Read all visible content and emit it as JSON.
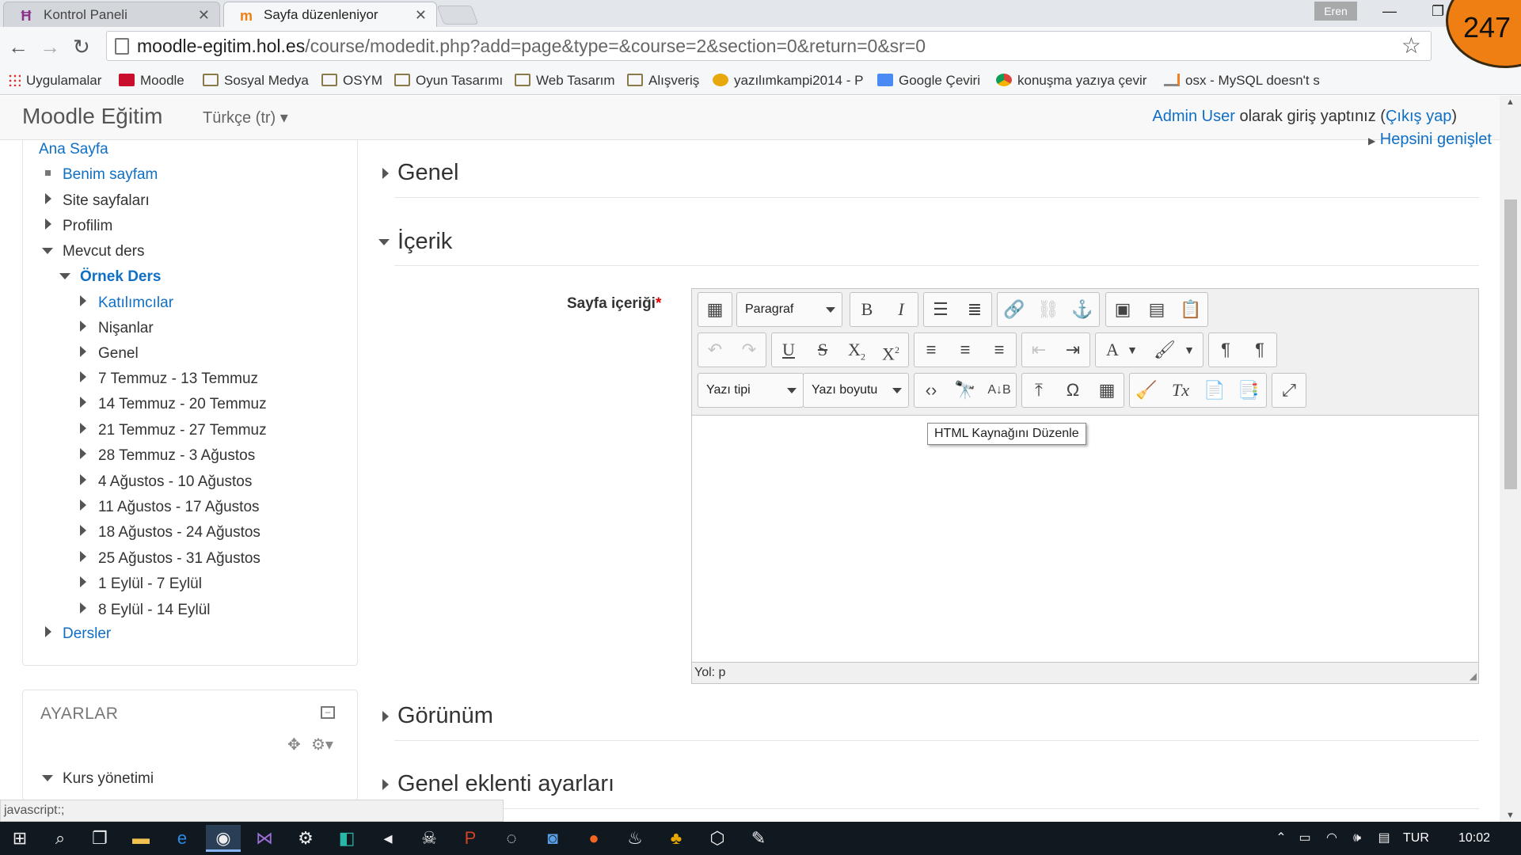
{
  "browser": {
    "tabs": [
      {
        "title": "Kontrol Paneli",
        "icon": "moodle-hat-icon"
      },
      {
        "title": "Sayfa düzenleniyor",
        "icon": "moodle-m-icon"
      }
    ],
    "user_chip": "Eren",
    "url_host": "moodle-egitim.hol.es",
    "url_path": "/course/modedit.php?add=page&type=&course=2&section=0&return=0&sr=0",
    "bookmarks": [
      {
        "label": "Uygulamalar",
        "icon": "apps-grid-icon"
      },
      {
        "label": "Moodle",
        "icon": "moodle-icon"
      },
      {
        "label": "Sosyal Medya",
        "icon": "folder-icon"
      },
      {
        "label": "OSYM",
        "icon": "folder-icon"
      },
      {
        "label": "Oyun Tasarımı",
        "icon": "folder-icon"
      },
      {
        "label": "Web Tasarım",
        "icon": "folder-icon"
      },
      {
        "label": "Alışveriş",
        "icon": "folder-icon"
      },
      {
        "label": "yazılımkampi2014 - P",
        "icon": "tiger-icon"
      },
      {
        "label": "Google Çeviri",
        "icon": "translate-icon"
      },
      {
        "label": "konuşma yazıya çevir",
        "icon": "chrome-icon"
      },
      {
        "label": "osx - MySQL doesn't s",
        "icon": "stackoverflow-icon"
      }
    ],
    "badge": "247"
  },
  "header": {
    "brand": "Moodle Eğitim",
    "language": "Türkçe (tr)",
    "login_user": "Admin User",
    "login_text": " olarak giriş yaptınız (",
    "logout": "Çıkış yap",
    "login_close": ")"
  },
  "nav": {
    "home": "Ana Sayfa",
    "my_page": "Benim sayfam",
    "site_pages": "Site sayfaları",
    "profile": "Profilim",
    "current_course": "Mevcut ders",
    "course": "Örnek Ders",
    "participants": "Katılımcılar",
    "badges": "Nişanlar",
    "general": "Genel",
    "weeks": [
      "7 Temmuz - 13 Temmuz",
      "14 Temmuz - 20 Temmuz",
      "21 Temmuz - 27 Temmuz",
      "28 Temmuz - 3 Ağustos",
      "4 Ağustos - 10 Ağustos",
      "11 Ağustos - 17 Ağustos",
      "18 Ağustos - 24 Ağustos",
      "25 Ağustos - 31 Ağustos",
      "1 Eylül - 7 Eylül",
      "8 Eylül - 14 Eylül"
    ],
    "courses": "Dersler"
  },
  "settings_block": {
    "title": "AYARLAR",
    "course_admin": "Kurs yönetimi"
  },
  "main": {
    "expand_all": "Hepsini genişlet",
    "sections": {
      "general": "Genel",
      "content": "İçerik",
      "appearance": "Görünüm",
      "plugin_settings": "Genel eklenti ayarları"
    },
    "field_label": "Sayfa içeriği",
    "required_mark": "*",
    "editor": {
      "paragraph": "Paragraf",
      "font_family": "Yazı tipi",
      "font_size": "Yazı boyutu",
      "tooltip": "HTML Kaynağını Düzenle",
      "path": "Yol: p"
    }
  },
  "status_bar": "javascript:;",
  "taskbar": {
    "language": "TUR",
    "time": "10:02"
  }
}
